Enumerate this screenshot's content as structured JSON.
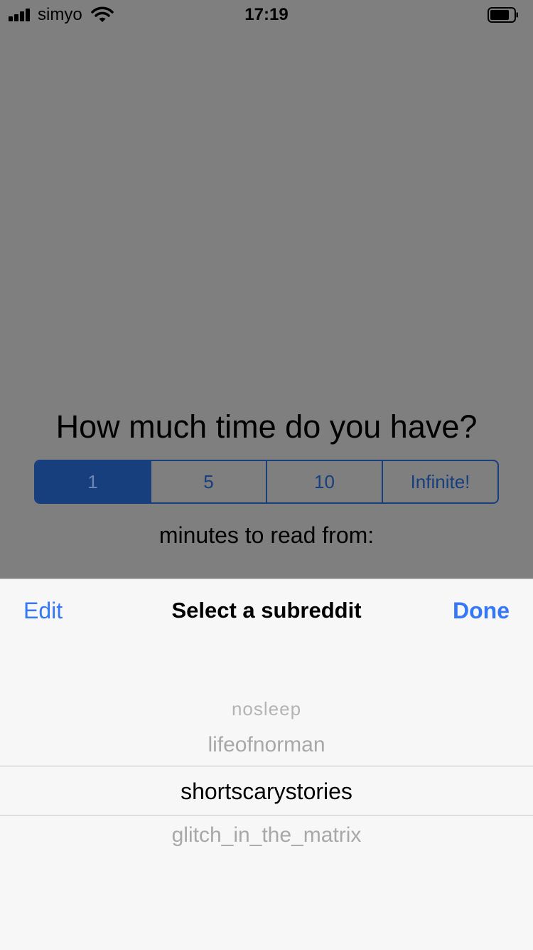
{
  "status_bar": {
    "carrier": "simyo",
    "time": "17:19"
  },
  "question": "How much time do you have?",
  "time_options": [
    "1",
    "5",
    "10",
    "Infinite!"
  ],
  "selected_time_option": "1",
  "subtitle": "minutes to read from:",
  "picker_sheet": {
    "edit_label": "Edit",
    "title": "Select a subreddit",
    "done_label": "Done",
    "items": [
      "nosleep",
      "lifeofnorman",
      "shortscarystories",
      "glitch_in_the_matrix"
    ],
    "selected_item": "shortscarystories"
  },
  "colors": {
    "accent": "#3478f6",
    "segment_blue": "#173e7d",
    "dim_overlay": "#7f7f7f",
    "sheet_background": "#f7f7f7"
  },
  "icons": [
    "cellular-signal-icon",
    "wifi-icon",
    "battery-icon"
  ]
}
